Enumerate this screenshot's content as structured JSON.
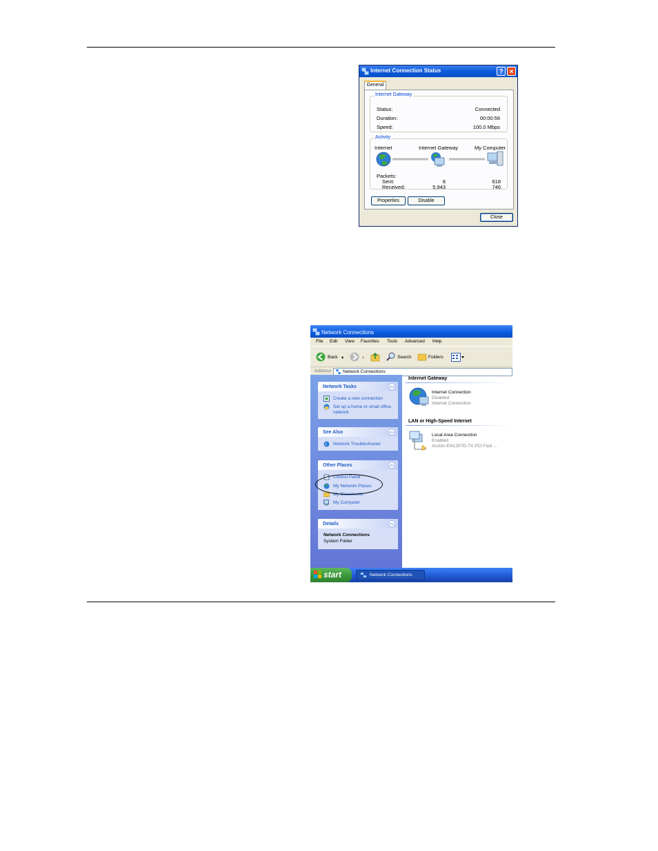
{
  "dialog": {
    "title": "Internet Connection Status",
    "tab": "General",
    "gateway_group": "Internet Gateway",
    "status_label": "Status:",
    "status_value": "Connected",
    "duration_label": "Duration:",
    "duration_value": "00:00:56",
    "speed_label": "Speed:",
    "speed_value": "100.0 Mbps",
    "activity_group": "Activity",
    "col_internet": "Internet",
    "col_gateway": "Internet Gateway",
    "col_computer": "My Computer",
    "packets_label": "Packets:",
    "sent_label": "Sent:",
    "received_label": "Received:",
    "sent_gateway": "8",
    "sent_computer": "618",
    "received_gateway": "5,943",
    "received_computer": "746",
    "properties_button": "Properties",
    "disable_button": "Disable",
    "close_button": "Close",
    "help_glyph": "?",
    "close_glyph": "×"
  },
  "window": {
    "title": "Network Connections",
    "menu": [
      "File",
      "Edit",
      "View",
      "Favorites",
      "Tools",
      "Advanced",
      "Help"
    ],
    "toolbar": {
      "back": "Back",
      "search": "Search",
      "folders": "Folders"
    },
    "address_label": "Address",
    "address_value": "Network Connections",
    "network_tasks": {
      "title": "Network Tasks",
      "items": [
        "Create a new connection",
        "Set up a home or small office network"
      ]
    },
    "see_also": {
      "title": "See Also",
      "items": [
        "Network Troubleshooter"
      ]
    },
    "other_places": {
      "title": "Other Places",
      "items": [
        "Control Panel",
        "My Network Places",
        "My Documents",
        "My Computer"
      ]
    },
    "details": {
      "title": "Details",
      "name": "Network Connections",
      "type": "System Folder"
    },
    "sections": [
      {
        "title": "Internet Gateway",
        "item": {
          "name": "Internet Connection",
          "status": "Disabled",
          "type": "Internet Connection"
        }
      },
      {
        "title": "LAN or High-Speed Internet",
        "item": {
          "name": "Local Area Connection",
          "status": "Enabled",
          "type": "Accton EN1207D-TX PCI Fast ..."
        }
      }
    ],
    "taskbar": {
      "start": "start",
      "task": "Network Connections"
    }
  },
  "colors": {
    "xp_blue": "#0a58d8",
    "link_blue": "#215dc6",
    "start_green": "#3c9a3c"
  }
}
